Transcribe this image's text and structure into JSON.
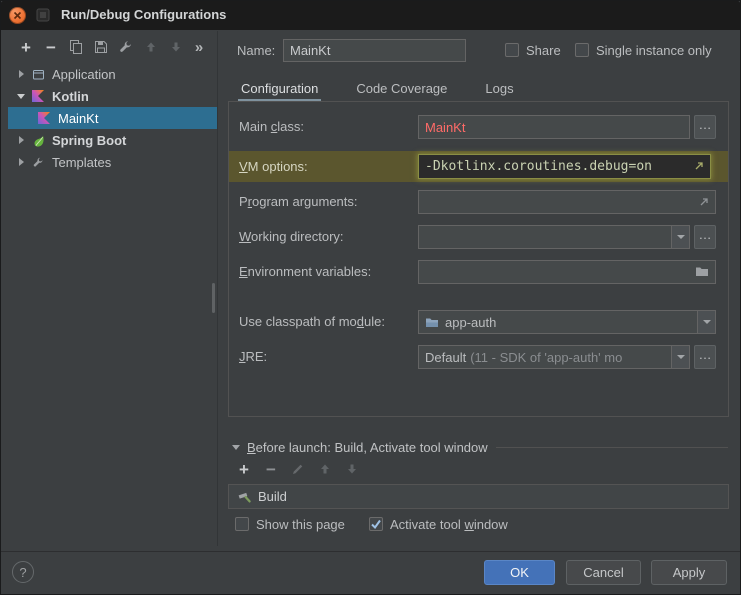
{
  "window": {
    "title": "Run/Debug Configurations"
  },
  "colors": {
    "dialog_bg": "#3c3f41",
    "titlebar_bg": "#1b1b1b",
    "field_bg": "#45494a",
    "field_border": "#646464",
    "tree_selection_blue": "#2d6e91",
    "vm_row_highlight_olive": "#5b562e",
    "vm_field_focus_green": "#8a8e45",
    "error_text_red": "#ff6b68",
    "ok_button_blue": "#4472b8",
    "close_button_orange": "#ee7234",
    "spring_green": "#65b33d"
  },
  "icons": {
    "add": "+",
    "remove": "−",
    "more": "»",
    "ellipsis": "…",
    "help": "?"
  },
  "tree": {
    "items": [
      {
        "label": "Application"
      },
      {
        "label": "Kotlin"
      },
      {
        "label": "MainKt"
      },
      {
        "label": "Spring Boot"
      },
      {
        "label": "Templates"
      }
    ]
  },
  "header": {
    "name_label": "Name:",
    "name_value": "MainKt",
    "share_label": "Share",
    "single_instance_label": "Single instance only"
  },
  "tabs": {
    "configuration": "Configuration",
    "code_coverage": "Code Coverage",
    "logs": "Logs"
  },
  "form": {
    "main_class": {
      "label_pre": "Main ",
      "label_key": "c",
      "label_post": "lass:",
      "value": "MainKt"
    },
    "vm_options": {
      "label_pre": "",
      "label_key": "V",
      "label_post": "M options:",
      "value": "-Dkotlinx.coroutines.debug=on"
    },
    "program_arguments": {
      "label_pre": "P",
      "label_key": "r",
      "label_post": "ogram arguments:",
      "value": ""
    },
    "working_directory": {
      "label_pre": "",
      "label_key": "W",
      "label_post": "orking directory:",
      "value": ""
    },
    "environment_variables": {
      "label_pre": "",
      "label_key": "E",
      "label_post": "nvironment variables:",
      "value": ""
    },
    "classpath_module": {
      "label_pre": "Use classpath of mo",
      "label_key": "d",
      "label_post": "ule:",
      "value": "app-auth"
    },
    "jre": {
      "label_pre": "",
      "label_key": "J",
      "label_post": "RE:",
      "value": "Default",
      "value_detail": "(11 - SDK of 'app-auth' mo"
    }
  },
  "before_launch": {
    "title_pre": "",
    "title_key": "B",
    "title_post": "efore launch: Build, Activate tool window",
    "build_item": "Build",
    "show_page_label": "Show this page",
    "activate_pre": "Activate tool ",
    "activate_key": "w",
    "activate_post": "indow"
  },
  "footer": {
    "ok": "OK",
    "cancel": "Cancel",
    "apply": "Apply"
  }
}
